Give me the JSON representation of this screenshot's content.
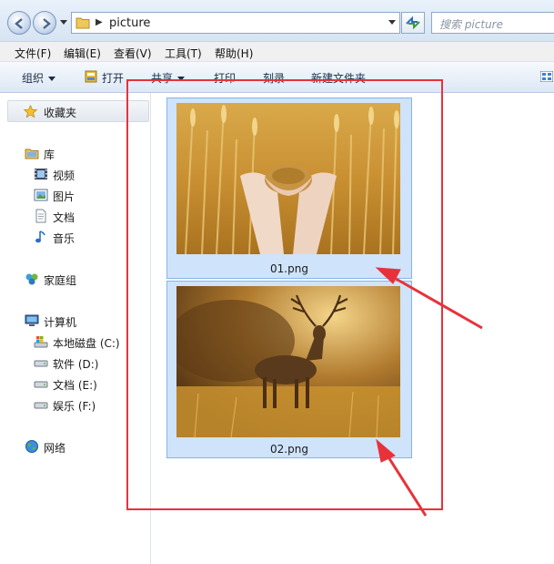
{
  "address": {
    "path_segment": "picture"
  },
  "search": {
    "placeholder": "搜索 picture"
  },
  "menu": {
    "items": [
      "文件(F)",
      "编辑(E)",
      "查看(V)",
      "工具(T)",
      "帮助(H)"
    ]
  },
  "toolbar": {
    "organize": "组织",
    "open": "打开",
    "share": "共享",
    "print": "打印",
    "burn": "刻录",
    "new_folder": "新建文件夹"
  },
  "nav": {
    "favorites": "收藏夹",
    "library": "库",
    "library_items": [
      "视频",
      "图片",
      "文档",
      "音乐"
    ],
    "homegroup": "家庭组",
    "computer": "计算机",
    "drives": [
      "本地磁盘 (C:)",
      "软件 (D:)",
      "文档 (E:)",
      "娱乐 (F:)"
    ],
    "network": "网络"
  },
  "files": [
    {
      "name": "01.png",
      "subject": "wheat-in-hands"
    },
    {
      "name": "02.png",
      "subject": "deer-in-field"
    }
  ],
  "colors": {
    "annotation_red": "#e8323a",
    "selection_fill": "#cfe3fb",
    "selection_border": "#86b4e8"
  }
}
